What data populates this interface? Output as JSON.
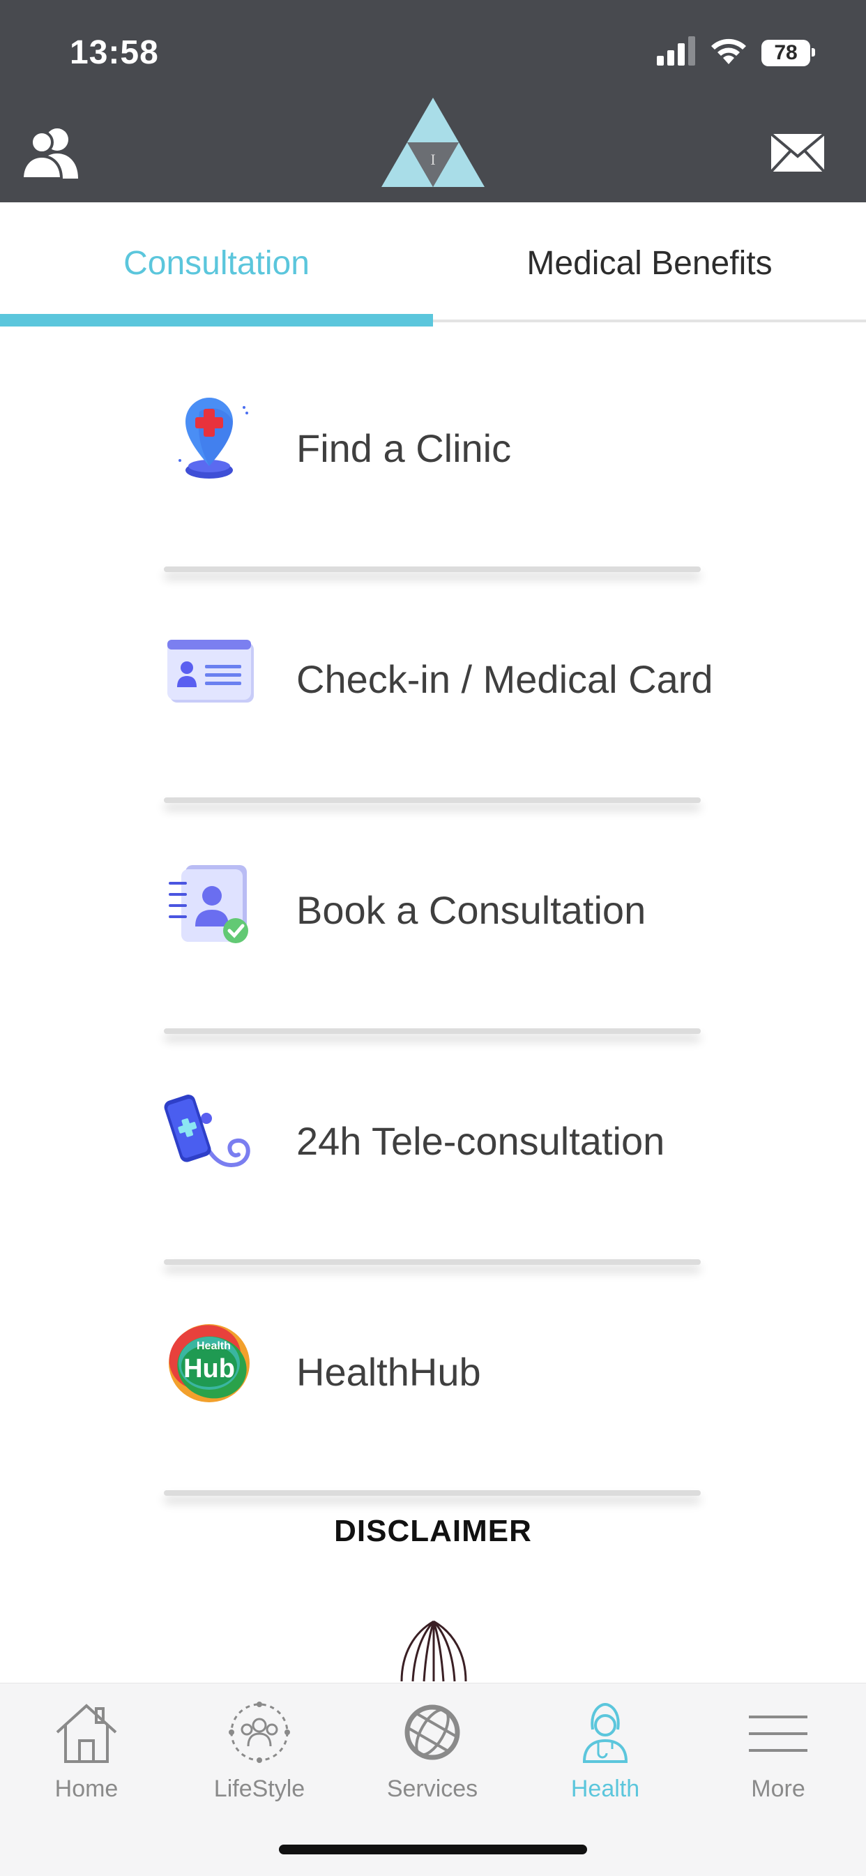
{
  "status_bar": {
    "time": "13:58",
    "battery": "78"
  },
  "header": {
    "profile_icon": "users-icon",
    "logo_icon": "triangle-logo-icon",
    "mail_icon": "envelope-icon"
  },
  "tabs": [
    {
      "label": "Consultation",
      "active": true
    },
    {
      "label": "Medical Benefits",
      "active": false
    }
  ],
  "menu": [
    {
      "label": "Find a Clinic",
      "icon": "location-pin-cross-icon"
    },
    {
      "label": "Check-in / Medical Card",
      "icon": "id-card-icon"
    },
    {
      "label": "Book a Consultation",
      "icon": "notebook-check-icon"
    },
    {
      "label": "24h Tele-consultation",
      "icon": "phone-stethoscope-icon"
    },
    {
      "label": "HealthHub",
      "icon": "healthhub-logo-icon",
      "logo_text": "Hub",
      "logo_subtext": "Health"
    }
  ],
  "disclaimer": "DISCLAIMER",
  "bottom_nav": [
    {
      "label": "Home",
      "icon": "home-icon",
      "active": false
    },
    {
      "label": "LifeStyle",
      "icon": "people-circle-icon",
      "active": false
    },
    {
      "label": "Services",
      "icon": "globe-icon",
      "active": false
    },
    {
      "label": "Health",
      "icon": "doctor-icon",
      "active": true
    },
    {
      "label": "More",
      "icon": "menu-lines-icon",
      "active": false
    }
  ],
  "colors": {
    "accent": "#5bc6dc",
    "header_bg": "#484a4f",
    "nav_bg": "#f5f5f6"
  }
}
